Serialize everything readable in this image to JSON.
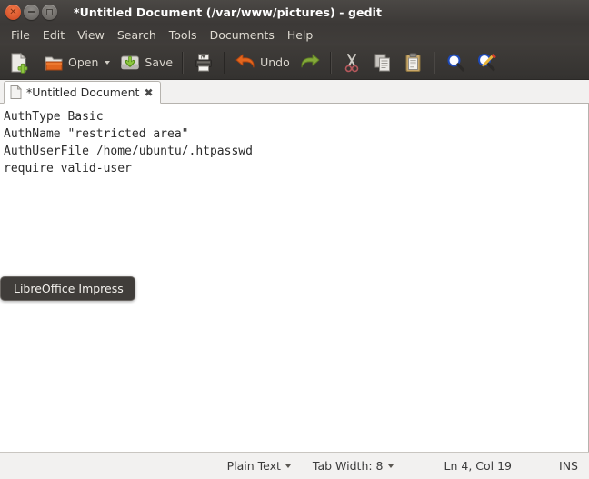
{
  "window": {
    "title": "*Untitled Document (/var/www/pictures) - gedit",
    "close_glyph": "✕",
    "controls": [
      {
        "name": "close",
        "label": "Close"
      },
      {
        "name": "minimize",
        "label": "Minimize"
      },
      {
        "name": "maximize",
        "label": "Maximize"
      }
    ]
  },
  "menubar": {
    "items": [
      {
        "label": "File"
      },
      {
        "label": "Edit"
      },
      {
        "label": "View"
      },
      {
        "label": "Search"
      },
      {
        "label": "Tools"
      },
      {
        "label": "Documents"
      },
      {
        "label": "Help"
      }
    ]
  },
  "toolbar": {
    "new_label": "",
    "new_icon": "new-document-icon",
    "open_label": "Open",
    "open_icon": "open-folder-icon",
    "save_label": "Save",
    "save_icon": "save-icon",
    "print_icon": "print-icon",
    "undo_label": "Undo",
    "undo_icon": "undo-arrow-icon",
    "redo_icon": "redo-arrow-icon",
    "cut_icon": "cut-scissors-icon",
    "copy_icon": "copy-icon",
    "paste_icon": "paste-clipboard-icon",
    "find_icon": "find-magnifier-icon",
    "replace_icon": "find-replace-icon"
  },
  "tab": {
    "title": "*Untitled Document",
    "close_glyph": "✖",
    "doc_icon": "document-icon"
  },
  "editor": {
    "content": "AuthType Basic\nAuthName \"restricted area\"\nAuthUserFile /home/ubuntu/.htpasswd\nrequire valid-user"
  },
  "tooltip": {
    "text": "LibreOffice Impress"
  },
  "statusbar": {
    "language": "Plain Text",
    "tab_width": "Tab Width: 8",
    "position": "Ln 4, Col 19",
    "insert_mode": "INS"
  },
  "colors": {
    "titlebar_dark": "#3c3937",
    "toolbar_dark": "#3a3735",
    "chrome_light": "#f2f1f0",
    "editor_bg": "#ffffff",
    "accent_orange": "#dd4814",
    "menu_text": "#dfdbd2",
    "code_text": "#2b2b2b"
  }
}
